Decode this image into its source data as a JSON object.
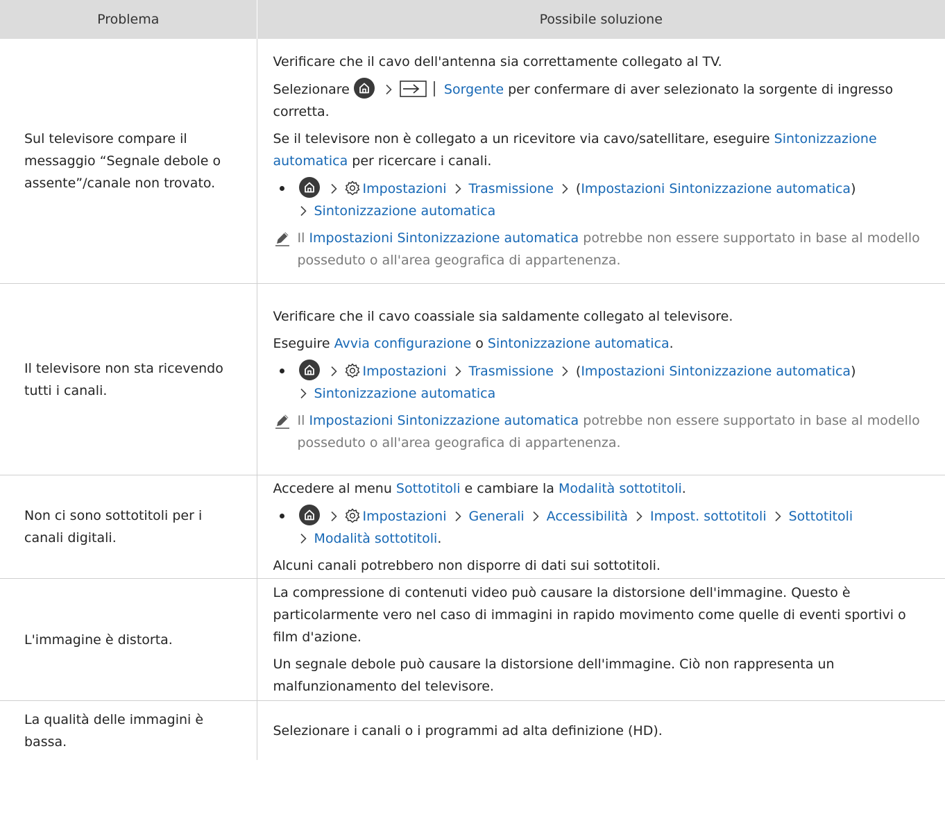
{
  "header": {
    "col_problem": "Problema",
    "col_solution": "Possibile soluzione"
  },
  "rows": [
    {
      "problem": "Sul televisore compare il messaggio “Segnale debole o assente”/canale non trovato.",
      "p1": "Verificare che il cavo dell'antenna sia correttamente collegato al TV.",
      "p2_a": "Selezionare",
      "p2_link": "Sorgente",
      "p2_b": "per confermare di aver selezionato la sorgente di ingresso corretta.",
      "p3_a": "Se il televisore non è collegato a un ricevitore via cavo/satellitare, eseguire",
      "p3_link": "Sintonizzazione automatica",
      "p3_b": "per ricercare i canali.",
      "path": {
        "impostazioni": "Impostazioni",
        "trasmissione": "Trasmissione",
        "paren_open": "(",
        "auto_settings": "Impostazioni Sintonizzazione automatica",
        "paren_close": ")",
        "auto": "Sintonizzazione automatica"
      },
      "note_a": "Il",
      "note_link": "Impostazioni Sintonizzazione automatica",
      "note_b": "potrebbe non essere supportato in base al modello posseduto o all'area geografica di appartenenza."
    },
    {
      "problem": "Il televisore non sta ricevendo tutti i canali.",
      "p1": "Verificare che il cavo coassiale sia saldamente collegato al televisore.",
      "p2_a": "Eseguire",
      "p2_link1": "Avvia configurazione",
      "p2_mid": "o",
      "p2_link2": "Sintonizzazione automatica",
      "p2_end": ".",
      "path": {
        "impostazioni": "Impostazioni",
        "trasmissione": "Trasmissione",
        "paren_open": "(",
        "auto_settings": "Impostazioni Sintonizzazione automatica",
        "paren_close": ")",
        "auto": "Sintonizzazione automatica"
      },
      "note_a": "Il",
      "note_link": "Impostazioni Sintonizzazione automatica",
      "note_b": "potrebbe non essere supportato in base al modello posseduto o all'area geografica di appartenenza."
    },
    {
      "problem": "Non ci sono sottotitoli per i canali digitali.",
      "p1_a": "Accedere al menu",
      "p1_link1": "Sottotitoli",
      "p1_mid": "e cambiare la",
      "p1_link2": "Modalità sottotitoli",
      "p1_end": ".",
      "path": {
        "impostazioni": "Impostazioni",
        "generali": "Generali",
        "accessibilita": "Accessibilità",
        "impost_sottotitoli": "Impost. sottotitoli",
        "sottotitoli": "Sottotitoli",
        "modalita": "Modalità sottotitoli",
        "end": "."
      },
      "p2": "Alcuni canali potrebbero non disporre di dati sui sottotitoli."
    },
    {
      "problem": "L'immagine è distorta.",
      "p1": "La compressione di contenuti video può causare la distorsione dell'immagine. Questo è particolarmente vero nel caso di immagini in rapido movimento come quelle di eventi sportivi o film d'azione.",
      "p2": "Un segnale debole può causare la distorsione dell'immagine. Ciò non rappresenta un malfunzionamento del televisore."
    },
    {
      "problem": "La qualità delle immagini è bassa.",
      "p1": "Selezionare i canali o i programmi ad alta definizione (HD)."
    }
  ],
  "icons": {
    "home": "home-icon",
    "gear": "gear-icon",
    "source": "source-input-icon",
    "chevron": "chevron-right-icon",
    "note": "pencil-note-icon"
  },
  "colors": {
    "link": "#1768b5",
    "header_bg": "#dcdcdc",
    "note_text": "#7a7a7a"
  }
}
